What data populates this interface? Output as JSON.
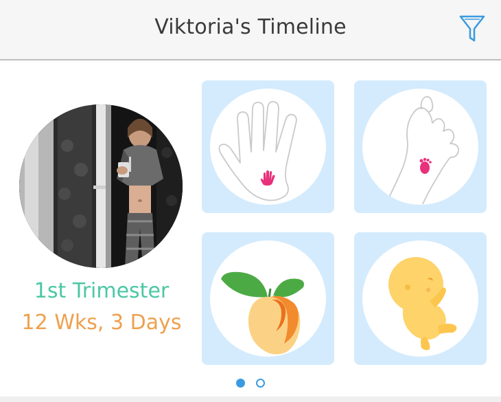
{
  "header": {
    "title": "Viktoria's Timeline",
    "filter_icon": "funnel-icon"
  },
  "profile": {
    "photo": "profile-photo",
    "trimester": "1st Trimester",
    "gestational_age": "12 Wks, 3 Days"
  },
  "tiles": [
    {
      "name": "hand-size-comparison",
      "icon": "hand-outline-icon"
    },
    {
      "name": "foot-size-comparison",
      "icon": "foot-outline-icon"
    },
    {
      "name": "fruit-size-comparison",
      "icon": "apricot-icon"
    },
    {
      "name": "baby-development",
      "icon": "fetus-icon"
    }
  ],
  "pagination": {
    "pages": 2,
    "current": 1
  },
  "colors": {
    "accent_blue": "#3b9be0",
    "tile_background": "#d4ebfd",
    "trimester_green": "#4cc7a3",
    "age_orange": "#eea04e",
    "baby_pink": "#e8317a",
    "fetus_yellow": "#fdd36a"
  }
}
